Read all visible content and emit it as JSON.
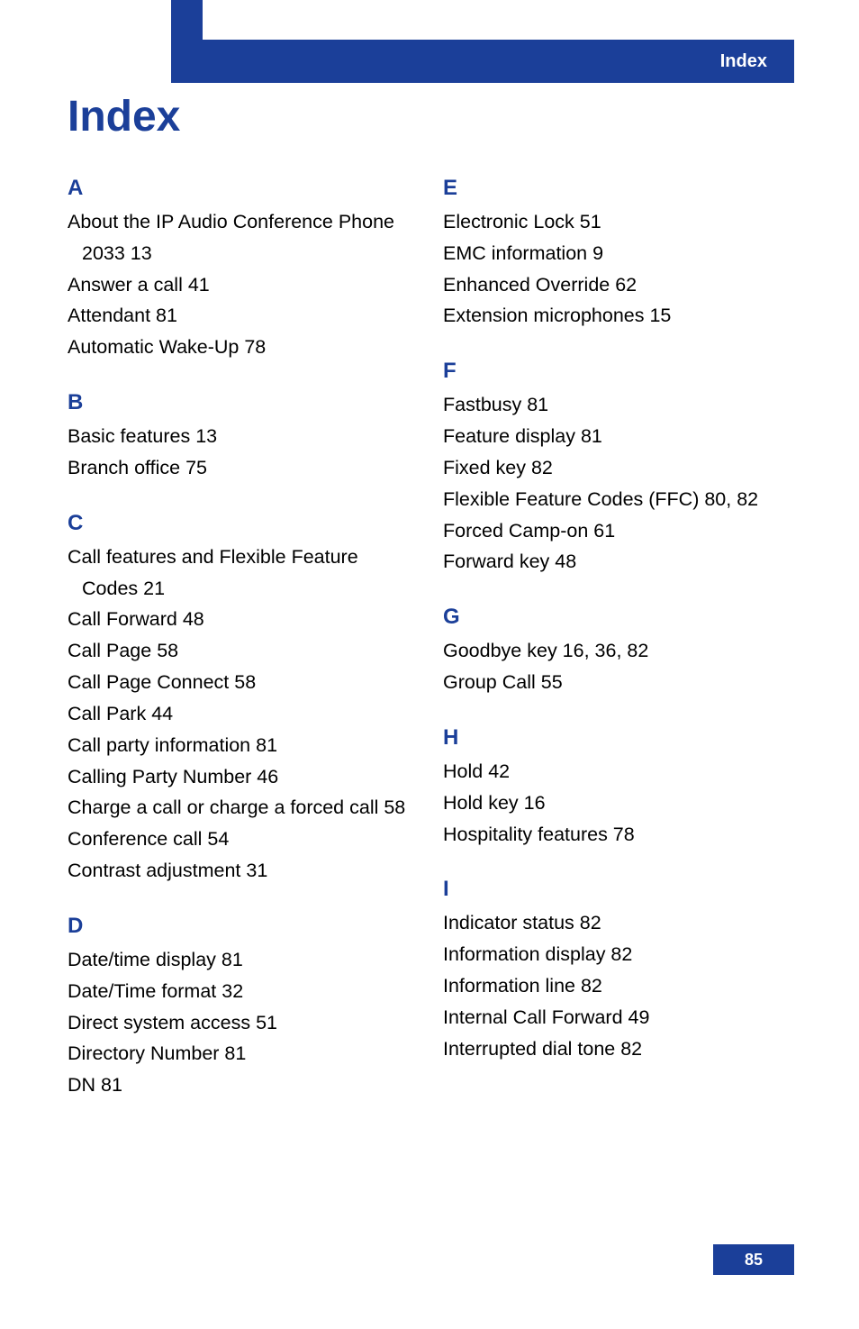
{
  "header_label": "Index",
  "page_title": "Index",
  "page_number": "85",
  "left": [
    {
      "letter": "A",
      "entries": [
        "About the IP Audio Conference Phone 2033 13",
        "Answer a call 41",
        "Attendant 81",
        "Automatic Wake-Up 78"
      ]
    },
    {
      "letter": "B",
      "entries": [
        "Basic features 13",
        "Branch office 75"
      ]
    },
    {
      "letter": "C",
      "entries": [
        "Call features and Flexible Feature Codes 21",
        "Call Forward 48",
        "Call Page 58",
        "Call Page Connect 58",
        "Call Park 44",
        "Call party information 81",
        "Calling Party Number 46",
        "Charge a call or charge a forced call 58",
        "Conference call 54",
        "Contrast adjustment 31"
      ]
    },
    {
      "letter": "D",
      "entries": [
        "Date/time display 81",
        "Date/Time format 32",
        "Direct system access 51",
        "Directory Number 81",
        "DN 81"
      ]
    }
  ],
  "right": [
    {
      "letter": "E",
      "entries": [
        "Electronic Lock 51",
        "EMC information 9",
        "Enhanced Override 62",
        "Extension microphones 15"
      ]
    },
    {
      "letter": "F",
      "entries": [
        "Fastbusy 81",
        "Feature display 81",
        "Fixed key 82",
        "Flexible Feature Codes (FFC) 80, 82",
        "Forced Camp-on 61",
        "Forward key 48"
      ]
    },
    {
      "letter": "G",
      "entries": [
        "Goodbye key 16, 36, 82",
        "Group Call 55"
      ]
    },
    {
      "letter": "H",
      "entries": [
        "Hold 42",
        "Hold key 16",
        "Hospitality features 78"
      ]
    },
    {
      "letter": "I",
      "entries": [
        "Indicator status 82",
        "Information display 82",
        "Information line 82",
        "Internal Call Forward 49",
        "Interrupted dial tone 82"
      ]
    }
  ]
}
